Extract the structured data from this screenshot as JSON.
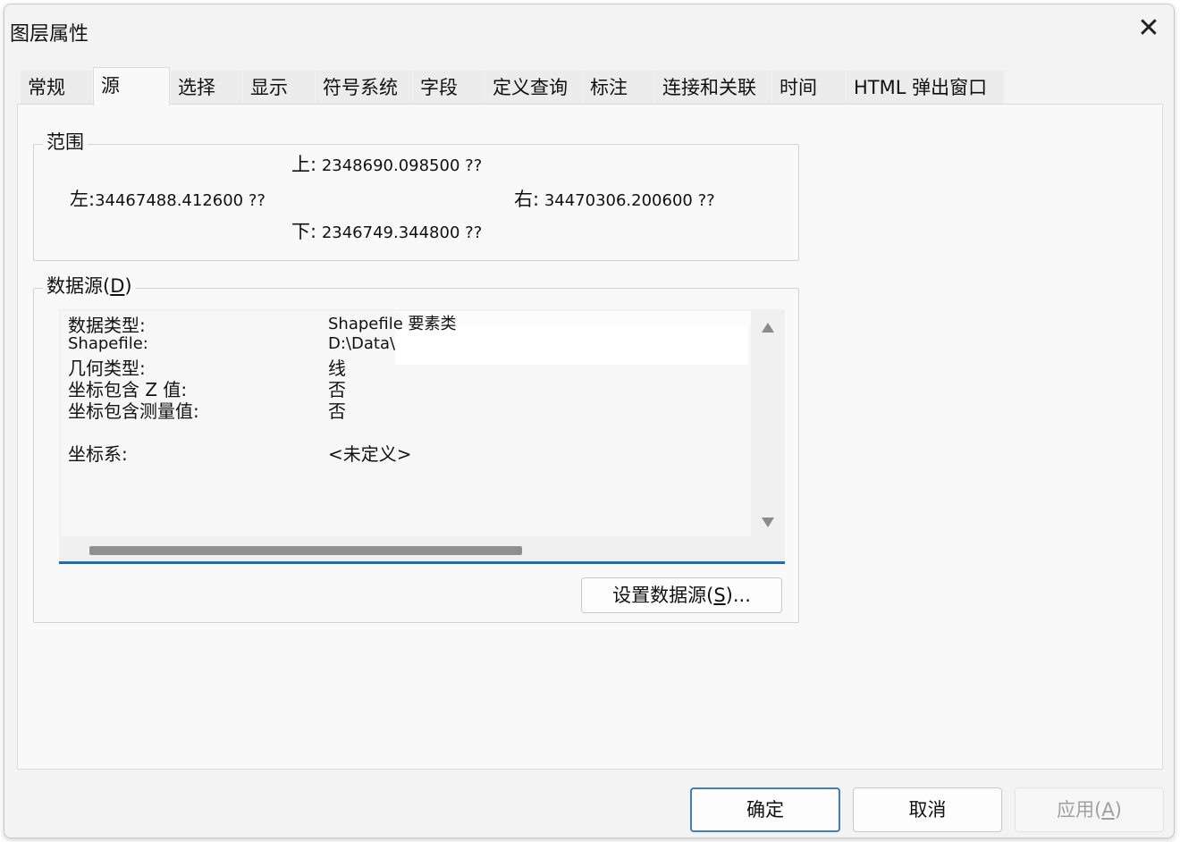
{
  "window": {
    "title": "图层属性",
    "close_glyph": "✕"
  },
  "tabs": [
    {
      "label": "常规",
      "active": false
    },
    {
      "label": "源",
      "active": true
    },
    {
      "label": "选择",
      "active": false
    },
    {
      "label": "显示",
      "active": false
    },
    {
      "label": "符号系统",
      "active": false
    },
    {
      "label": "字段",
      "active": false
    },
    {
      "label": "定义查询",
      "active": false
    },
    {
      "label": "标注",
      "active": false
    },
    {
      "label": "连接和关联",
      "active": false
    },
    {
      "label": "时间",
      "active": false
    },
    {
      "label": "HTML 弹出窗口",
      "active": false
    }
  ],
  "extent": {
    "legend": "范围",
    "top_label": "上:",
    "top_value": "2348690.098500 ??",
    "left_label": "左:",
    "left_value": "34467488.412600 ??",
    "right_label": "右:",
    "right_value": "34470306.200600 ??",
    "bottom_label": "下:",
    "bottom_value": "2346749.344800 ??"
  },
  "datasource": {
    "legend_text": "数据源(",
    "legend_key": "D",
    "legend_close": ")",
    "rows": [
      {
        "key": "数据类型:",
        "value": "Shapefile 要素类"
      },
      {
        "key": "Shapefile:",
        "value": "D:\\Data\\"
      },
      {
        "key": "几何类型:",
        "value": "线"
      },
      {
        "key": "坐标包含 Z 值:",
        "value": "否"
      },
      {
        "key": "坐标包含测量值:",
        "value": "否"
      },
      {
        "key": "坐标系:",
        "value": "<未定义>"
      }
    ],
    "set_button_text": "设置数据源(",
    "set_button_key": "S",
    "set_button_close": ")..."
  },
  "buttons": {
    "ok": "确定",
    "cancel": "取消",
    "apply_text": "应用(",
    "apply_key": "A",
    "apply_close": ")"
  }
}
